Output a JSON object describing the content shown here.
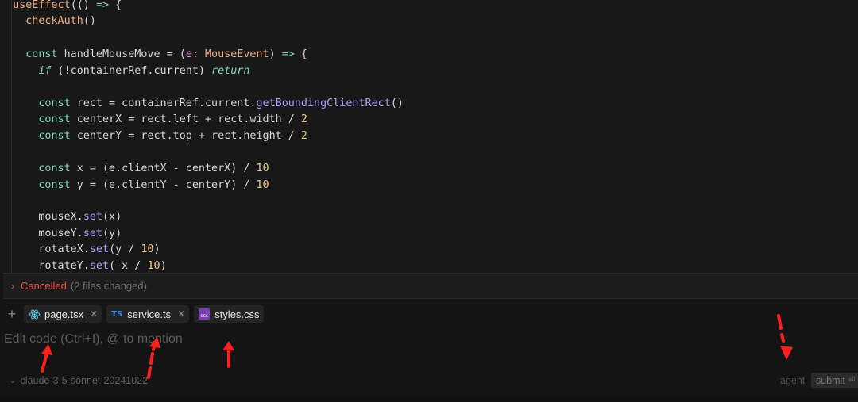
{
  "code_lines": [
    "  useEffect(() => {",
    "    checkAuth()",
    "",
    "    const handleMouseMove = (e: MouseEvent) => {",
    "      if (!containerRef.current) return",
    "",
    "      const rect = containerRef.current.getBoundingClientRect()",
    "      const centerX = rect.left + rect.width / 2",
    "      const centerY = rect.top + rect.height / 2",
    "",
    "      const x = (e.clientX - centerX) / 10",
    "      const y = (e.clientY - centerY) / 10",
    "",
    "      mouseX.set(x)",
    "      mouseY.set(y)",
    "      rotateX.set(y / 10)",
    "      rotateY.set(-x / 10)"
  ],
  "status": {
    "label": "Cancelled",
    "changes": "(2 files changed)"
  },
  "context_files": [
    {
      "name": "page.tsx",
      "icon": "react-icon"
    },
    {
      "name": "service.ts",
      "icon": "typescript-icon",
      "badge": "TS"
    },
    {
      "name": "styles.css",
      "icon": "css-icon",
      "badge": "css"
    }
  ],
  "input": {
    "placeholder": "Edit code (Ctrl+I), @ to mention"
  },
  "footer": {
    "model": "claude-3-5-sonnet-20241022",
    "mode": "agent",
    "submit_label": "submit",
    "enter_glyph": "⏎"
  },
  "annotation_color": "#ff1f1f"
}
